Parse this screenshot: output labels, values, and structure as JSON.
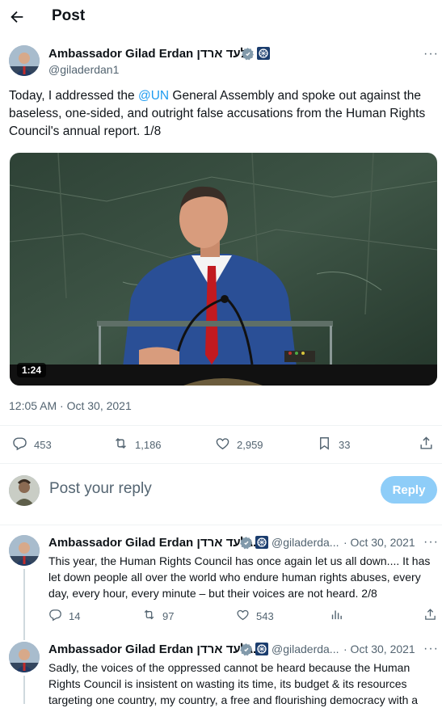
{
  "header": {
    "title": "Post"
  },
  "post": {
    "author_name": "Ambassador Gilad Erdan גלעד ארדן",
    "author_handle": "@giladerdan1",
    "text_before": "Today, I addressed the ",
    "mention": "@UN",
    "text_after": " General Assembly and spoke out against the baseless, one-sided, and outright false accusations from the Human Rights Council's annual report. 1/8",
    "video_duration": "1:24",
    "timestamp": "12:05 AM · Oct 30, 2021",
    "replies": "453",
    "reposts": "1,186",
    "likes": "2,959",
    "bookmarks": "33"
  },
  "reply_box": {
    "placeholder": "Post your reply",
    "button": "Reply"
  },
  "replies": [
    {
      "author_name": "Ambassador Gilad Erdan גלעד ארדן...",
      "handle": "@giladerda...",
      "date": "· Oct 30, 2021",
      "text": "This year, the Human Rights Council has once again let us all down.... It has let down people all over the world who endure human rights abuses, every day, every hour, every minute – but their voices are not heard. 2/8",
      "replies": "14",
      "reposts": "97",
      "likes": "543"
    },
    {
      "author_name": "Ambassador Gilad Erdan גלעד ארדן...",
      "handle": "@giladerda...",
      "date": "· Oct 30, 2021",
      "text": "Sadly, the voices of the oppressed cannot be heard because the Human Rights Council is insistent on wasting its time, its budget & its resources targeting one country, my country, a free and flourishing democracy with a"
    }
  ],
  "colors": {
    "accent": "#1d9bf0",
    "reply_button": "#8ecdf8",
    "muted": "#536471"
  }
}
